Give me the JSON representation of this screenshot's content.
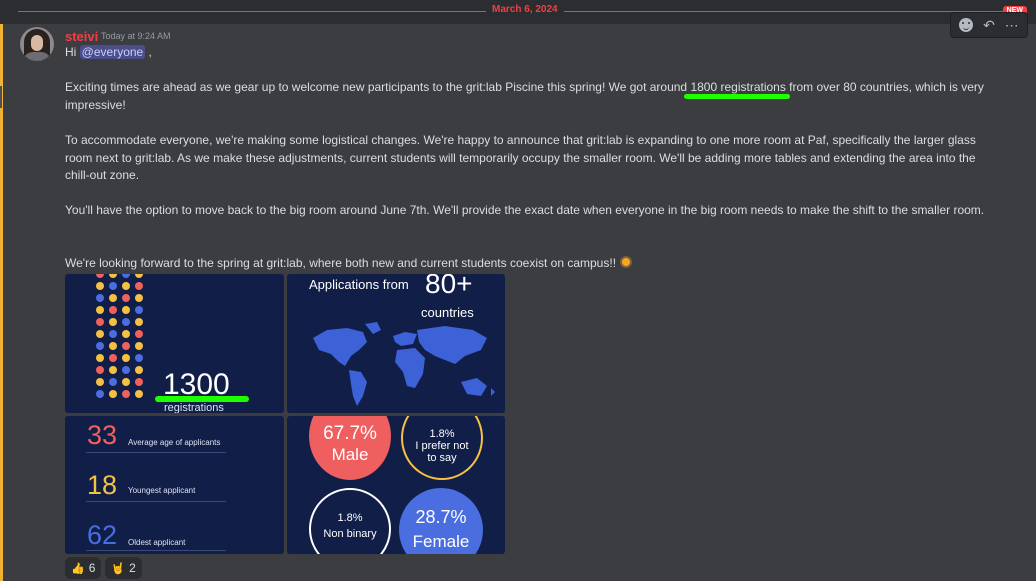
{
  "divider": {
    "date": "March 6, 2024",
    "badge": "NEW"
  },
  "message": {
    "username": "steivi",
    "timestamp": "Today at 9:24 AM",
    "greeting_prefix": "Hi ",
    "mention": "@everyone",
    "greeting_suffix": " ,",
    "p1_before": "Exciting times are ahead as we gear up to welcome new participants to the grit:lab Piscine this spring! We got around ",
    "p1_highlight": "1800 registrations",
    "p1_after": " from over 80 countries, which is very impressive!",
    "p2": "To accommodate everyone, we're making some logistical changes. We're happy to announce that grit:lab is expanding to one more room at Paf, specifically the larger glass room next to grit:lab. As we make these adjustments, current students will temporarily occupy the smaller room. We'll be adding more tables and extending the area into the chill-out zone.",
    "p3": "You'll have the option to move back to the big room around June 7th. We'll provide the exact date when everyone in the big room needs to make the shift to the smaller room.",
    "p4": "We're  looking forward to the spring at grit:lab, where both new and current students coexist on campus!! "
  },
  "hover_toolbar": {
    "icons": [
      "emoji-icon",
      "reply-icon",
      "more-icon"
    ]
  },
  "images": {
    "registrations": {
      "number": "1300",
      "label": "registrations",
      "dot_colors": [
        "#f0605d",
        "#f6c042",
        "#4a6ee0",
        "#f6c042"
      ]
    },
    "countries": {
      "title": "Applications from",
      "number": "80+",
      "subtitle": "countries"
    },
    "ages": [
      {
        "value": "33",
        "label": "Average age of applicants",
        "color": "#f0605d"
      },
      {
        "value": "18",
        "label": "Youngest applicant",
        "color": "#f6c042"
      },
      {
        "value": "62",
        "label": "Oldest applicant",
        "color": "#4a6ee0"
      }
    ],
    "gender": {
      "male": {
        "pct": "67.7%",
        "label": "Male"
      },
      "prefer_not": {
        "pct": "1.8%",
        "label1": "I prefer not",
        "label2": "to say"
      },
      "non_binary": {
        "pct": "1.8%",
        "label": "Non binary"
      },
      "female": {
        "pct": "28.7%",
        "label": "Female"
      }
    }
  },
  "reactions": [
    {
      "emoji": "thumbs-up",
      "count": "6"
    },
    {
      "emoji": "metal-hand",
      "count": "2"
    }
  ],
  "colors": {
    "accent_red": "#f23f43",
    "highlight_green": "#1eff00",
    "mention_bg": "#4a4f8c"
  }
}
